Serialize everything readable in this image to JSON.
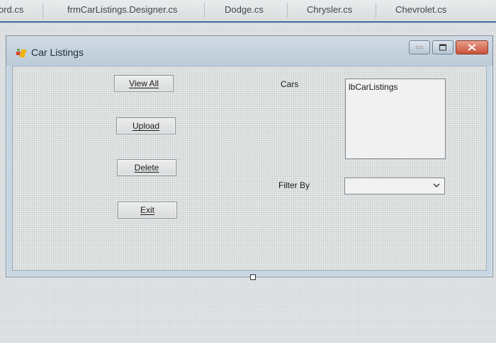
{
  "tabs": [
    {
      "label": "ord.cs"
    },
    {
      "label": "frmCarListings.Designer.cs"
    },
    {
      "label": "Dodge.cs"
    },
    {
      "label": "Chrysler.cs"
    },
    {
      "label": "Chevrolet.cs"
    }
  ],
  "form": {
    "title": "Car Listings",
    "icon": "windows-form-icon",
    "caption_buttons": [
      "minimize-icon",
      "maximize-icon",
      "close-icon"
    ]
  },
  "buttons": {
    "view_all": "View All",
    "upload": "Upload",
    "delete": "Delete",
    "exit": "Exit"
  },
  "labels": {
    "cars": "Cars",
    "filter_by": "Filter By"
  },
  "listbox": {
    "text": "lbCarListings"
  },
  "combo": {
    "value": ""
  },
  "colors": {
    "tab_rule": "#3d6fa0",
    "close_button": "#c9513a",
    "form_border": "#c7d6e3"
  }
}
